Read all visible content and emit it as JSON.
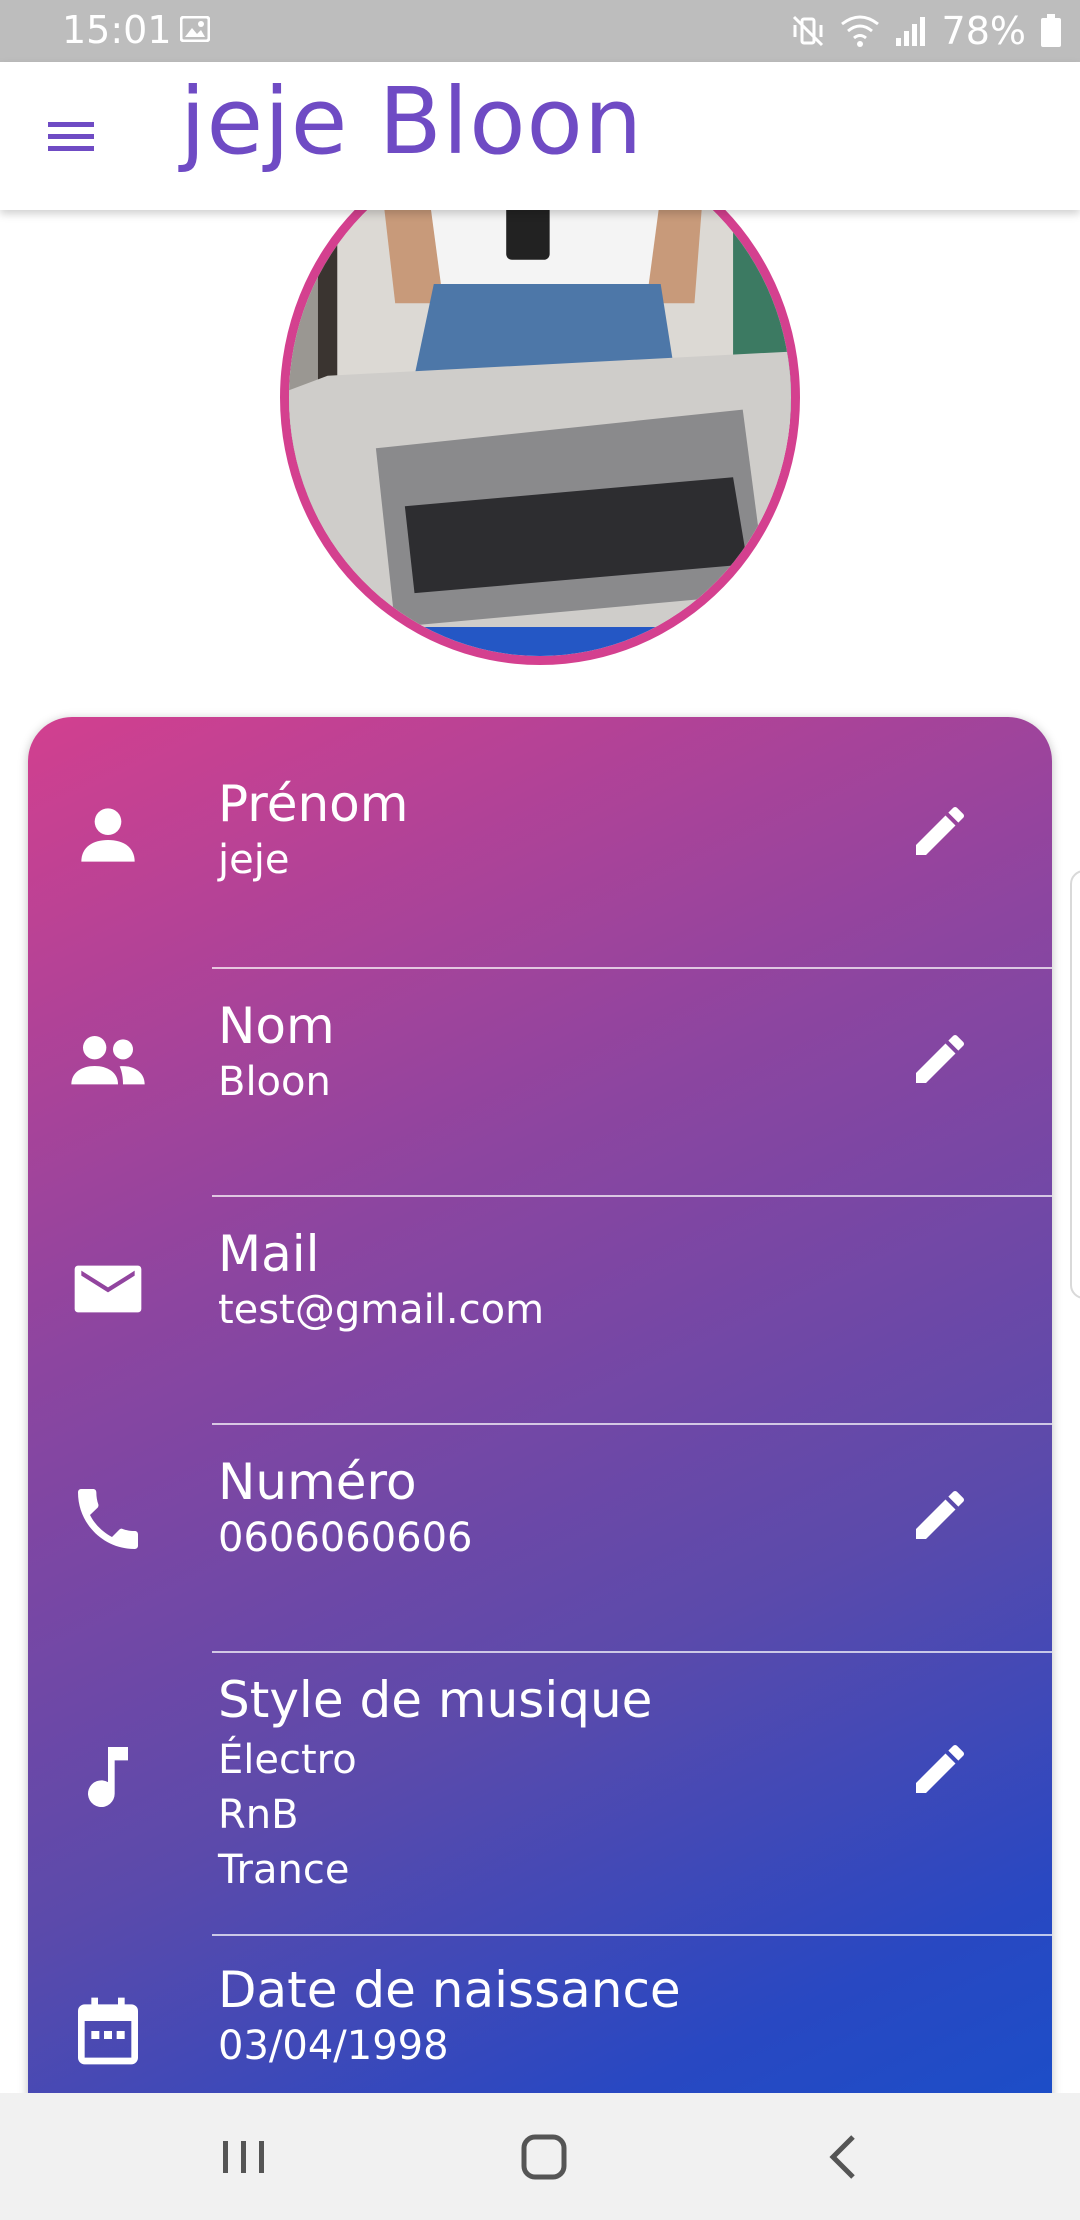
{
  "status_bar": {
    "time": "15:01",
    "battery": "78%",
    "icons": [
      "image-icon",
      "mute-vibrate-icon",
      "wifi-icon",
      "signal-icon",
      "battery-icon"
    ]
  },
  "app_bar": {
    "title": "jeje Bloon",
    "menu_icon": "menu-icon",
    "accent": "#6f4bc4"
  },
  "avatar": {
    "border_color": "#d4408f"
  },
  "profile_fields": [
    {
      "icon": "person-icon",
      "label": "Prénom",
      "values": [
        "jeje"
      ],
      "editable": true
    },
    {
      "icon": "people-icon",
      "label": "Nom",
      "values": [
        "Bloon"
      ],
      "editable": true
    },
    {
      "icon": "mail-icon",
      "label": "Mail",
      "values": [
        "test@gmail.com"
      ],
      "editable": false
    },
    {
      "icon": "phone-icon",
      "label": "Numéro",
      "values": [
        "0606060606"
      ],
      "editable": true
    },
    {
      "icon": "music-note-icon",
      "label": "Style de musique",
      "values": [
        "Électro",
        "RnB",
        "Trance"
      ],
      "editable": true
    },
    {
      "icon": "calendar-icon",
      "label": "Date de naissance",
      "values": [
        "03/04/1998"
      ],
      "editable": false
    }
  ],
  "colors": {
    "gradient_start": "#d2408f",
    "gradient_mid": "#8c45a0",
    "gradient_end": "#1b4ec8"
  },
  "nav_bar": {
    "buttons": [
      "recent-apps-icon",
      "home-icon",
      "back-icon"
    ]
  }
}
